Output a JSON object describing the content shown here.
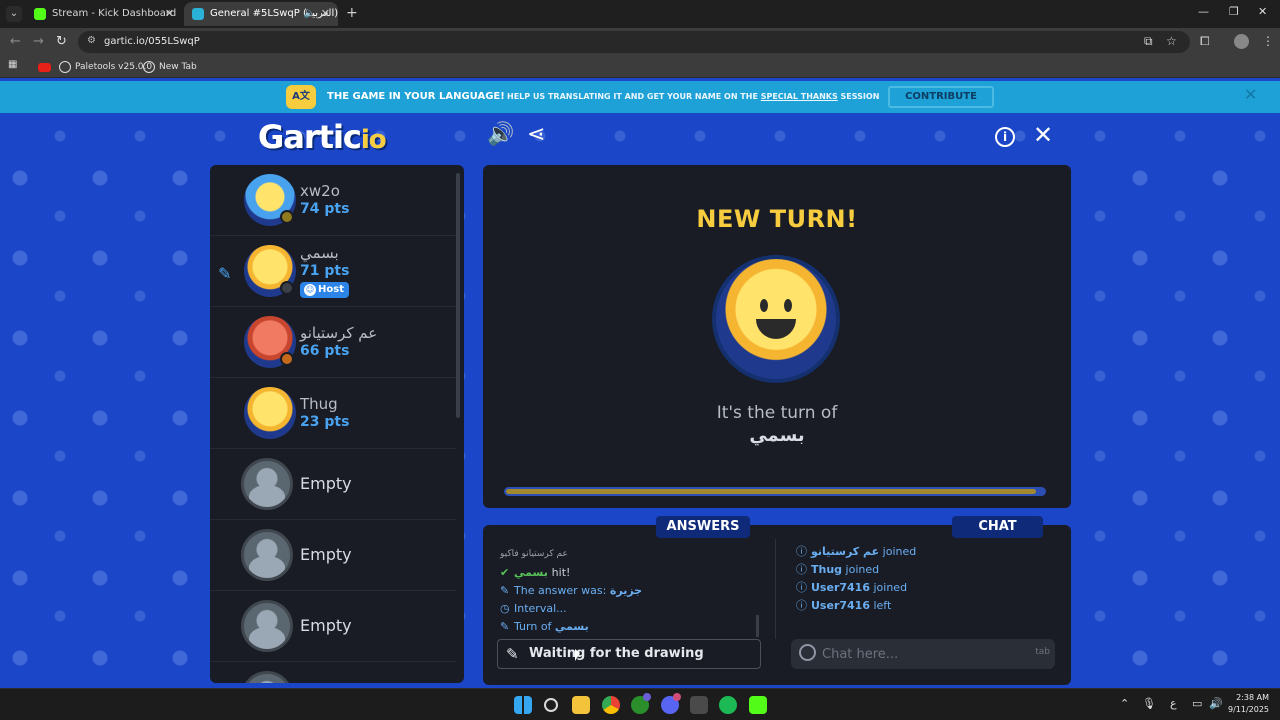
{
  "browser": {
    "tabs": [
      {
        "title": "Stream - Kick Dashboard",
        "favicon_color": "#53fc18"
      },
      {
        "title": "General #5LSwqP (العربية) ·",
        "favicon_color": "#2bb0d6"
      }
    ],
    "url": "gartic.io/055LSwqP",
    "bookmarks": [
      "Paletools v25.0.0",
      "New Tab"
    ]
  },
  "banner": {
    "icon_text": "A文",
    "headline": "THE GAME IN YOUR LANGUAGE!",
    "sub_prefix": "HELP US TRANSLATING IT AND GET YOUR NAME ON THE",
    "sub_link": "SPECIAL THANKS",
    "sub_suffix": "SESSION",
    "contribute_label": "CONTRIBUTE"
  },
  "header": {
    "logo_main": "Gartic",
    "logo_suffix": "io",
    "icons": [
      "speaker-icon",
      "share-icon",
      "info-icon",
      "close-icon"
    ]
  },
  "players": [
    {
      "name": "xw2o",
      "points": "74 pts",
      "avatar": "blue",
      "dot_color": "#8f7a1e"
    },
    {
      "name": "بسمي",
      "points": "71 pts",
      "avatar": "face",
      "dot_color": "#3b3f47",
      "host": "Host",
      "drawing": true
    },
    {
      "name": "عم كرستيانو",
      "points": "66 pts",
      "avatar": "red",
      "dot_color": "#c56a1c"
    },
    {
      "name": "Thug",
      "points": "23 pts",
      "avatar": "face",
      "dot_color": "#f7cd3f"
    },
    {
      "name": "Empty",
      "empty": true
    },
    {
      "name": "Empty",
      "empty": true
    },
    {
      "name": "Empty",
      "empty": true
    }
  ],
  "turn": {
    "headline": "NEW TURN!",
    "turn_of": "It's the turn of",
    "player": "بسمي",
    "progress": 0.985
  },
  "answers": {
    "label": "ANSWERS",
    "messages": [
      {
        "text": "عم كرستيانو فاكيو",
        "kind": "dim"
      },
      {
        "name": "بسمي",
        "text": "hit!",
        "kind": "hit"
      },
      {
        "text": "The answer was:",
        "word": "جزيرة",
        "kind": "answer"
      },
      {
        "text": "Interval...",
        "kind": "interval"
      },
      {
        "text": "Turn of",
        "word": "بسمي",
        "kind": "turn"
      }
    ],
    "input_text": "Waiting for the drawing"
  },
  "chat": {
    "label": "CHAT",
    "messages": [
      {
        "name": "عم كرستيانو",
        "action": "joined"
      },
      {
        "name": "Thug",
        "action": "joined"
      },
      {
        "name": "User7416",
        "action": "joined"
      },
      {
        "name": "User7416",
        "action": "left"
      }
    ],
    "placeholder": "Chat here...",
    "tab_hint": "tab"
  },
  "taskbar": {
    "time": "2:38 AM",
    "date": "9/11/2025",
    "lang": "ع"
  }
}
